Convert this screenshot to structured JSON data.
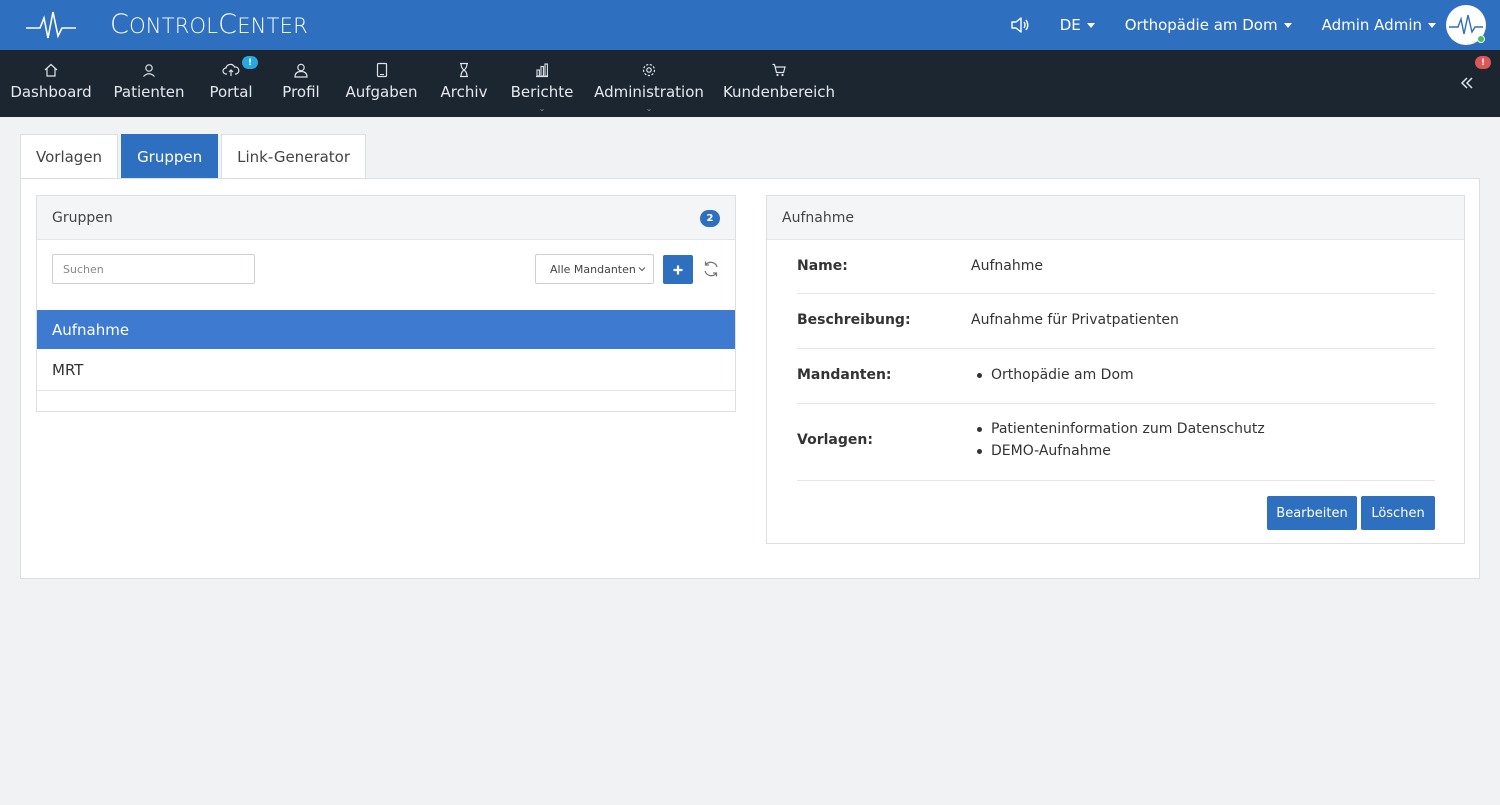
{
  "header": {
    "brand_big1": "C",
    "brand_small1": "ONTROL",
    "brand_big2": "C",
    "brand_small2": "ENTER",
    "language": "DE",
    "clinic": "Orthopädie am Dom",
    "user": "Admin Admin",
    "accent": "#2f6fbf"
  },
  "nav": {
    "items": [
      {
        "label": "Dashboard",
        "icon": "home-icon"
      },
      {
        "label": "Patienten",
        "icon": "patients-icon"
      },
      {
        "label": "Portal",
        "icon": "cloud-icon",
        "badge": "!"
      },
      {
        "label": "Profil",
        "icon": "user-icon"
      },
      {
        "label": "Aufgaben",
        "icon": "tablet-icon"
      },
      {
        "label": "Archiv",
        "icon": "hourglass-icon"
      },
      {
        "label": "Berichte",
        "icon": "bar-chart-icon"
      },
      {
        "label": "Administration",
        "icon": "gear-icon"
      },
      {
        "label": "Kundenbereich",
        "icon": "cart-icon"
      }
    ],
    "collapse_badge": "!"
  },
  "tabs": [
    "Vorlagen",
    "Gruppen",
    "Link-Generator"
  ],
  "groups_panel": {
    "title": "Gruppen",
    "count": "2",
    "search_placeholder": "Suchen",
    "filter_value": "Alle Mandanten",
    "rows": [
      "Aufnahme",
      "MRT"
    ]
  },
  "detail_panel": {
    "title": "Aufnahme",
    "name_label": "Name:",
    "name_value": "Aufnahme",
    "desc_label": "Beschreibung:",
    "desc_value": "Aufnahme für Privatpatienten",
    "mandanten_label": "Mandanten:",
    "mandanten": [
      "Orthopädie am Dom"
    ],
    "vorlagen_label": "Vorlagen:",
    "vorlagen": [
      "Patienteninformation zum Datenschutz",
      "DEMO-Aufnahme"
    ],
    "edit_label": "Bearbeiten",
    "delete_label": "Löschen"
  }
}
